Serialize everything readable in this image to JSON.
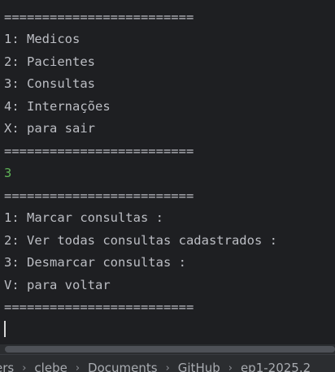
{
  "terminal": {
    "lines": [
      "=========================",
      "1: Medicos",
      "2: Pacientes",
      "3: Consultas",
      "4: Internações",
      "X: para sair",
      "=========================",
      "3",
      "=========================",
      "1: Marcar consultas :",
      "2: Ver todas consultas cadastrados :",
      "3: Desmarcar consultas :",
      "V: para voltar",
      "========================="
    ]
  },
  "breadcrumb": {
    "items": [
      "ers",
      "clebe",
      "Documents",
      "GitHub",
      "ep1-2025.2"
    ],
    "separator": "›"
  },
  "colors": {
    "background": "#1e1f22",
    "text": "#bcbec4",
    "input_echo": "#5fb357",
    "statusbar": "#2b2d30"
  }
}
